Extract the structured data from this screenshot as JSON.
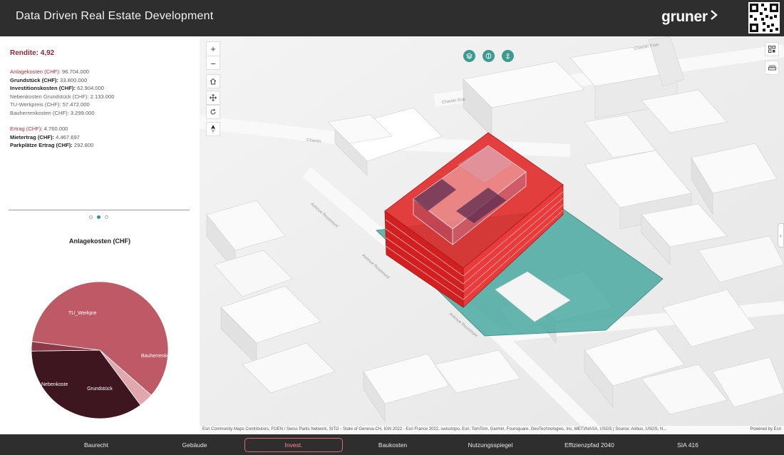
{
  "header": {
    "title": "Data Driven Real Estate Development",
    "logo_text": "gruner"
  },
  "summary": {
    "rendite_label": "Rendite: 4,92",
    "costs": [
      {
        "label": "Anlagekosten (CHF):",
        "value": " 96.704.000",
        "style": "red"
      },
      {
        "label": "Grundstück (CHF):",
        "value": " 33.800.000",
        "style": "bold"
      },
      {
        "label": "Investitionskosten (CHF):",
        "value": " 62.904.000",
        "style": "bold"
      },
      {
        "label": "Nebenkosten Grundstück (CHF):",
        "value": " 2.133.000",
        "style": "muted"
      },
      {
        "label": "TU-Werkpreis (CHF):",
        "value": " 57.472.000",
        "style": "muted"
      },
      {
        "label": "Bauherrenkosten (CHF):",
        "value": " 3.299.000",
        "style": "muted"
      }
    ],
    "revenue": [
      {
        "label": "Ertrag (CHF):",
        "value": " 4.760.000",
        "style": "red"
      },
      {
        "label": "Mietertrag (CHF):",
        "value": " 4.467.697",
        "style": "bold"
      },
      {
        "label": "Parkplätze Ertrag (CHF):",
        "value": " 292.800",
        "style": "bold"
      }
    ]
  },
  "chart_data": {
    "type": "pie",
    "title": "Anlagekosten (CHF)",
    "slices": [
      {
        "name": "TU_Werkpre",
        "value": 57472000,
        "color": "#bd5a66"
      },
      {
        "name": "Bauherrenko",
        "value": 3299000,
        "color": "#e0a7ad"
      },
      {
        "name": "Grundstück",
        "value": 33800000,
        "color": "#3d1620"
      },
      {
        "name": "Nebenkoste",
        "value": 2133000,
        "color": "#8a3a48"
      }
    ]
  },
  "map": {
    "streets": [
      "Avenue Rosemont",
      "Avenue Rosemont",
      "Avenue Rosemont",
      "Chemin Erai",
      "Chemin",
      "Chemin Fran"
    ],
    "attribution": "Esri Community Maps Contributors, FOEN / Swiss Parks Network, SITG - State of Geneva-CH, IGN 2022 - Esri France 2022, swisstopo, Esri, TomTom, Garmin, Foursquare, GeoTechnologies, Inc, METI/NASA, USGS | Source: Airbus, USGS, N...",
    "powered_by": "Powered by Esri",
    "zoom_in": "+",
    "zoom_out": "−"
  },
  "footer": {
    "tabs": [
      "Baurecht",
      "Gebäude",
      "Invest.",
      "Baukosten",
      "Nutzungsspiegel",
      "Effizienzpfad 2040",
      "SIA 416"
    ],
    "active": "Invest."
  },
  "colors": {
    "accent": "#3e9a8e",
    "header_bg": "#2e2e2e",
    "building": "#e02a2a",
    "plot": "#4aa9a0"
  }
}
